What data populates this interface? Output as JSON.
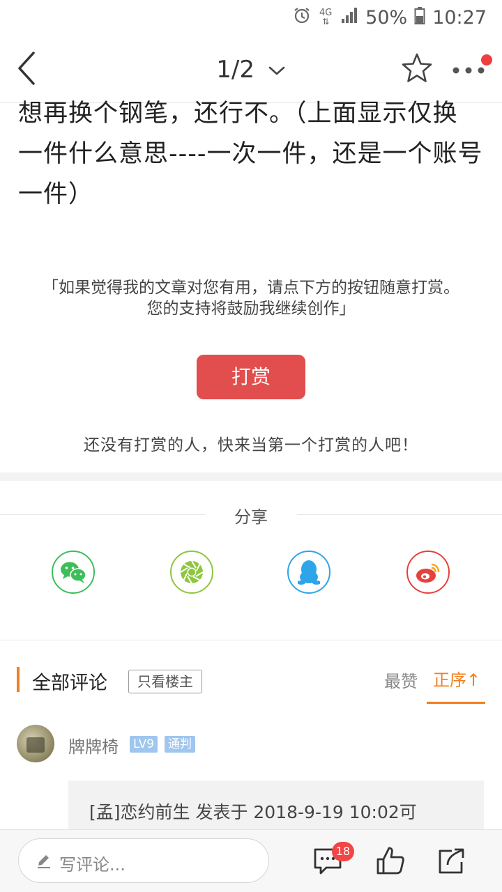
{
  "status_bar": {
    "network": "4G",
    "battery": "50%",
    "time": "10:27",
    "icons": [
      "alarm-icon",
      "network-4g-icon",
      "signal-icon",
      "battery-icon"
    ]
  },
  "nav": {
    "page_indicator": "1/2",
    "icons": [
      "back-arrow-icon",
      "chevron-down-icon",
      "star-icon",
      "more-dots-icon"
    ]
  },
  "article": {
    "lines": [
      "想再换个钢笔，还行不。（上面显示仅换",
      "一件什么意思----一次一件，还是一个账号",
      "一件）"
    ]
  },
  "reward": {
    "message_line1": "「如果觉得我的文章对您有用，请点下方的按钮随意打赏。",
    "message_line2": "您的支持将鼓励我继续创作」",
    "button_label": "打赏",
    "empty_text": "还没有打赏的人，快来当第一个打赏的人吧！"
  },
  "share": {
    "title": "分享",
    "targets": [
      {
        "name": "wechat",
        "icon": "wechat-icon",
        "color": "#3dbe5a"
      },
      {
        "name": "moments",
        "icon": "moments-icon",
        "color": "#8dc63f"
      },
      {
        "name": "qq",
        "icon": "qq-icon",
        "color": "#2ea5e8"
      },
      {
        "name": "weibo",
        "icon": "weibo-icon",
        "color": "#e6413c"
      }
    ]
  },
  "comments": {
    "title": "全部评论",
    "op_only": "只看楼主",
    "sort_most_liked": "最赞",
    "sort_ascending": "正序↑",
    "items": [
      {
        "username": "牌牌椅",
        "level": "LV9",
        "title_badge": "通判",
        "quote": "[孟]恋约前生 发表于 2018-9-19 10:02可"
      }
    ]
  },
  "bottom_bar": {
    "comment_placeholder": "写评论...",
    "comment_count": "18",
    "icons": [
      "pen-icon",
      "comment-bubble-icon",
      "thumbs-up-icon",
      "share-icon"
    ]
  },
  "colors": {
    "accent_orange": "#f08020",
    "reward_red": "#e24d4d",
    "badge_blue": "#9fc6ee",
    "notify_red": "#f04646"
  }
}
